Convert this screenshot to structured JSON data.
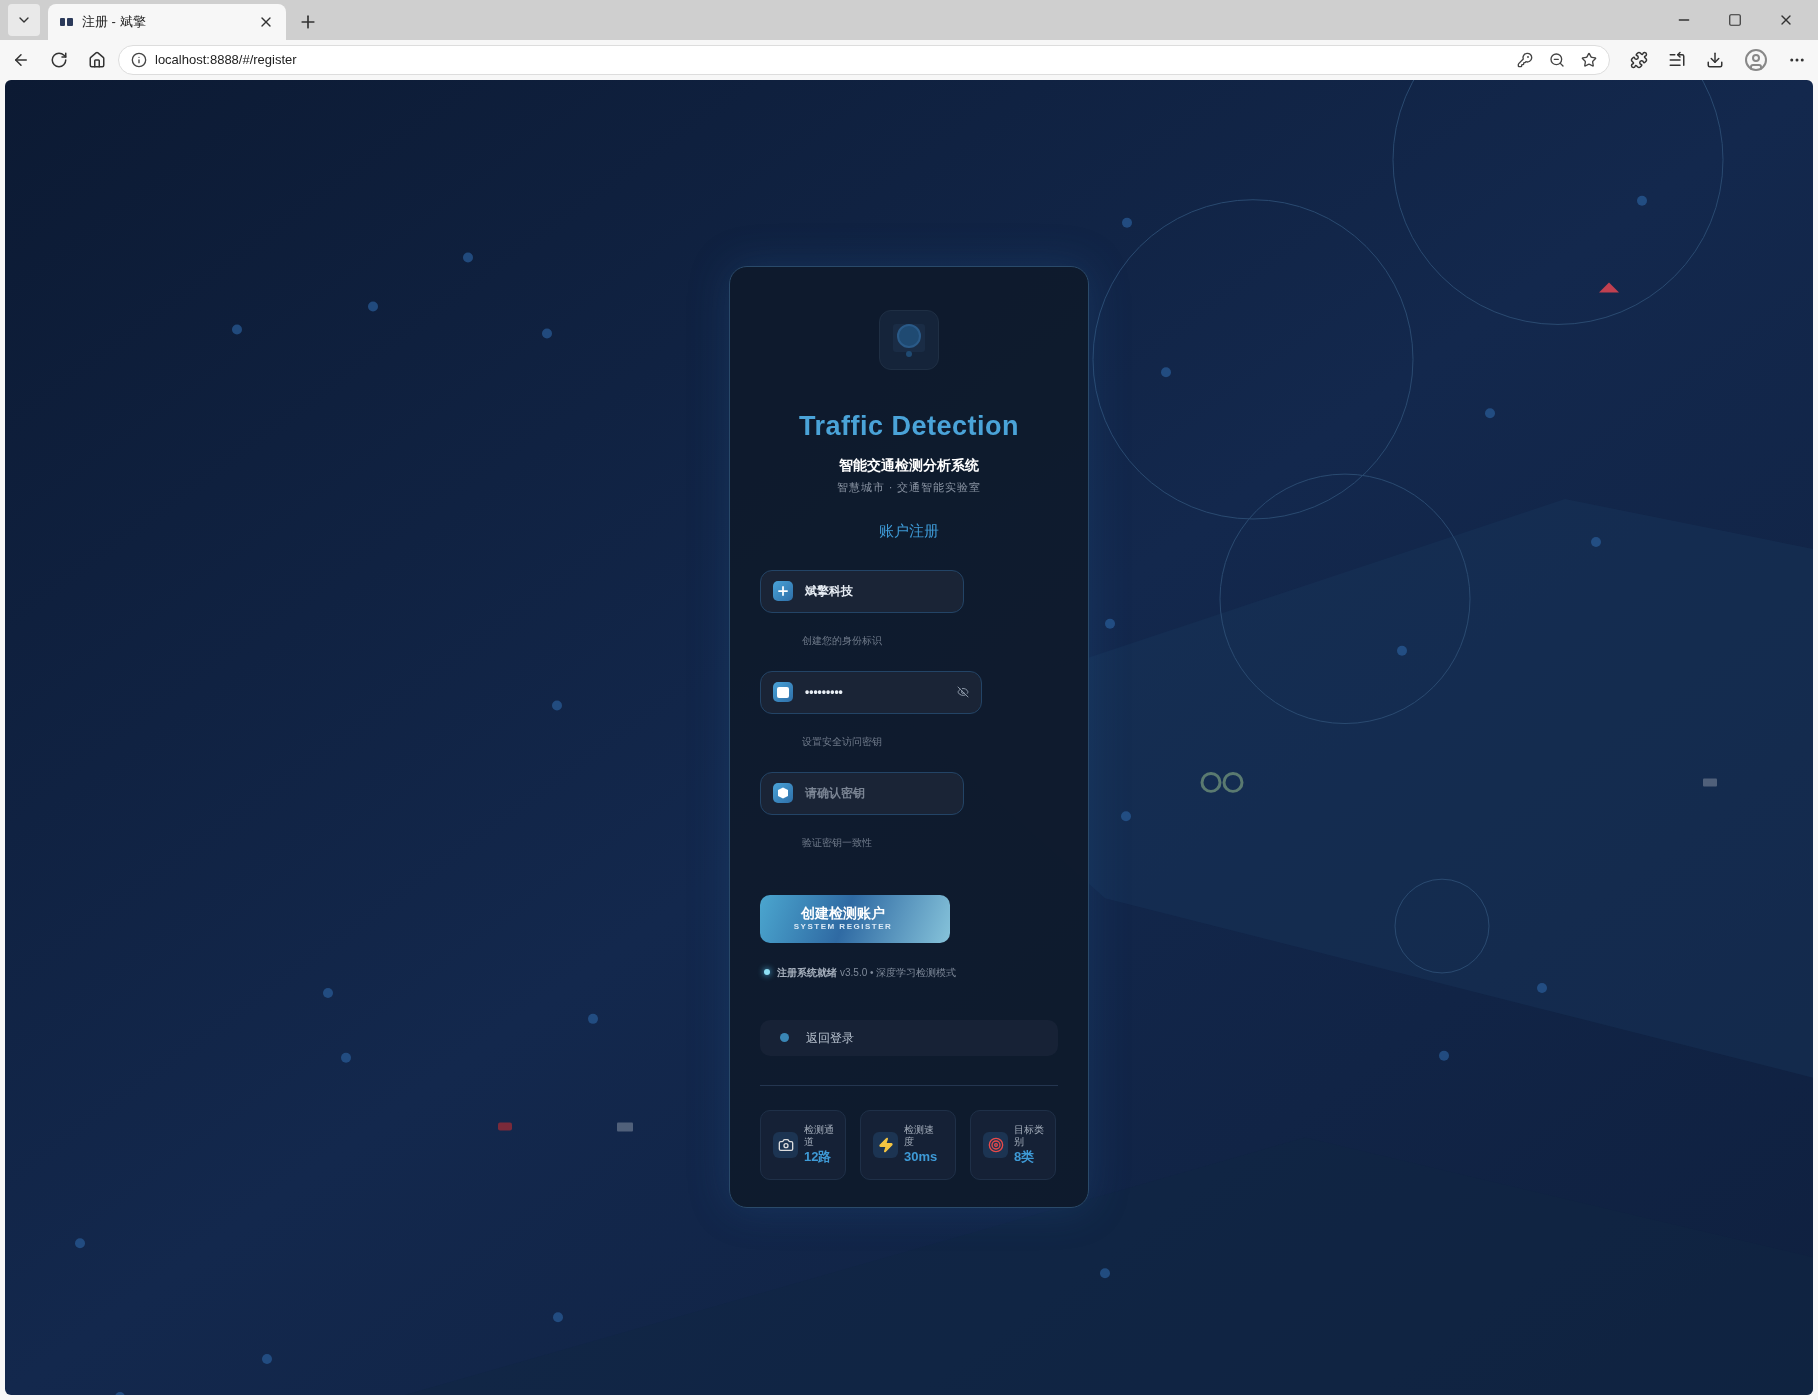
{
  "browser": {
    "tab_title": "注册 - 斌擎",
    "url": "localhost:8888/#/register"
  },
  "card": {
    "title": "Traffic Detection",
    "subtitle": "智能交通检测分析系统",
    "org": "智慧城市 · 交通智能实验室",
    "heading": "账户注册",
    "fields": [
      {
        "kind": "text",
        "value": "斌擎科技",
        "hint": "创建您的身份标识"
      },
      {
        "kind": "password",
        "value": "•••••••••",
        "masked": true,
        "hint": "设置安全访问密钥"
      },
      {
        "kind": "confirm",
        "placeholder": "请确认密钥",
        "hint": "验证密钥一致性"
      }
    ],
    "submit": {
      "label": "创建检测账户",
      "sublabel": "SYSTEM REGISTER"
    },
    "status": {
      "ready": true,
      "label": "注册系统就绪",
      "detail": "v3.5.0 • 深度学习检测模式"
    },
    "back_link": "返回登录",
    "stats": [
      {
        "kind": "camera",
        "label": "检测通道",
        "value": "12路"
      },
      {
        "kind": "speed",
        "label": "检测速度",
        "value": "30ms"
      },
      {
        "kind": "target",
        "label": "目标类别",
        "value": "8类"
      }
    ]
  }
}
